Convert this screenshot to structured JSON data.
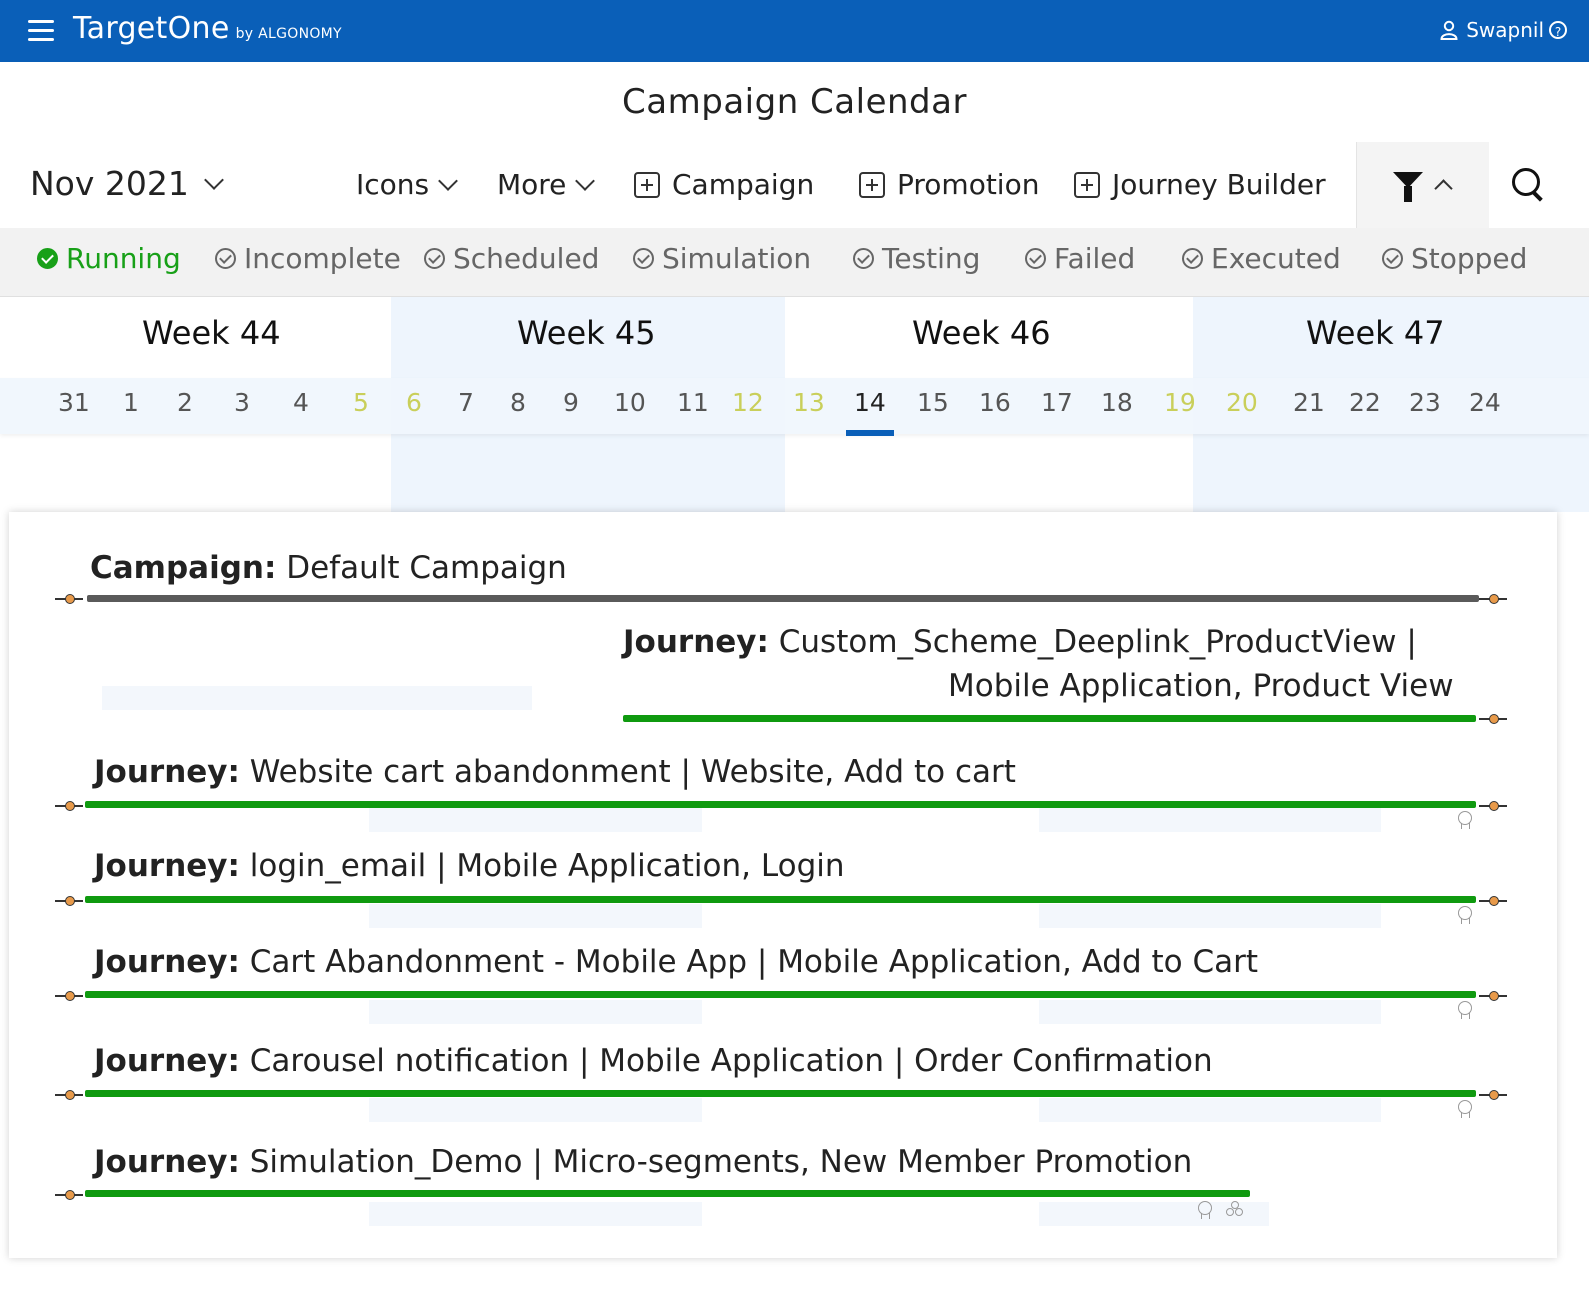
{
  "app": {
    "brand": "TargetOne",
    "brand_sub": "by ALGONOMY",
    "user": "Swapnil"
  },
  "page": {
    "title": "Campaign Calendar"
  },
  "toolbar": {
    "month": "Nov 2021",
    "icons_label": "Icons",
    "more_label": "More",
    "campaign_label": "Campaign",
    "promotion_label": "Promotion",
    "journey_label": "Journey Builder"
  },
  "statuses": [
    "Running",
    "Incomplete",
    "Scheduled",
    "Simulation",
    "Testing",
    "Failed",
    "Executed",
    "Stopped"
  ],
  "weeks": [
    "Week 44",
    "Week 45",
    "Week 46",
    "Week 47"
  ],
  "days": [
    "31",
    "1",
    "2",
    "3",
    "4",
    "5",
    "6",
    "7",
    "8",
    "9",
    "10",
    "11",
    "12",
    "13",
    "14",
    "15",
    "16",
    "17",
    "18",
    "19",
    "20",
    "21",
    "22",
    "23",
    "24"
  ],
  "rows": [
    {
      "type": "Campaign:",
      "name": "Default Campaign"
    },
    {
      "type": "Journey:",
      "name": "Custom_Scheme_Deeplink_ProductView |",
      "name2": "Mobile Application, Product View"
    },
    {
      "type": "Journey:",
      "name": "Website cart abandonment | Website, Add to cart"
    },
    {
      "type": "Journey:",
      "name": "login_email | Mobile Application, Login"
    },
    {
      "type": "Journey:",
      "name": "Cart Abandonment - Mobile App | Mobile Application, Add to Cart"
    },
    {
      "type": "Journey:",
      "name": "Carousel notification | Mobile Application | Order Confirmation"
    },
    {
      "type": "Journey:",
      "name": "Simulation_Demo | Micro-segments, New Member Promotion"
    }
  ],
  "colors": {
    "brand_blue": "#0a5fb8",
    "running_green": "#18a018",
    "weekend_yellow": "#c9cf5a"
  }
}
